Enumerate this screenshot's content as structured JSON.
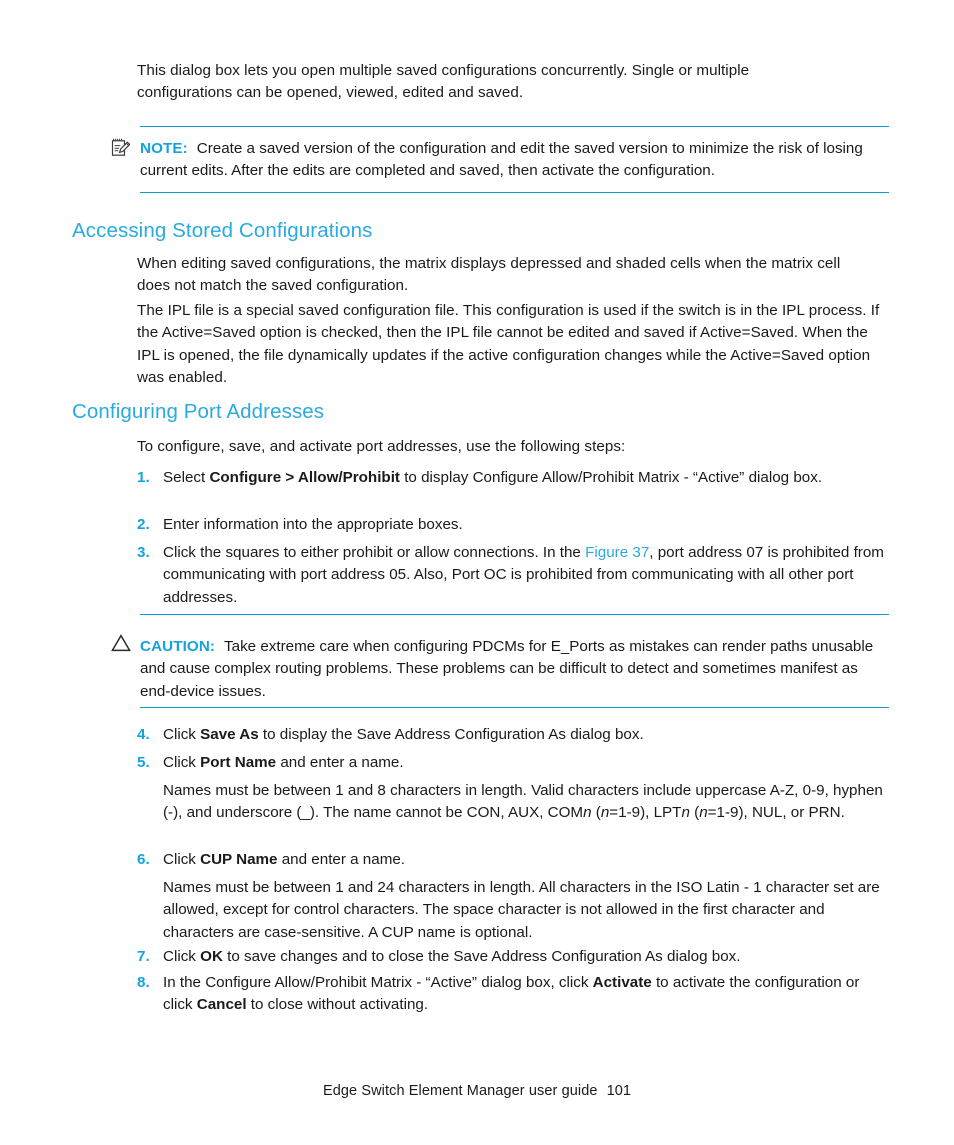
{
  "page": {
    "footer_title": "Edge Switch Element Manager user guide",
    "footer_page_number": "101",
    "accent_color": "#2aaae1",
    "rule_color": "#0b9ad4"
  },
  "intro": {
    "paragraph": "This dialog box lets you open multiple saved configurations concurrently. Single or multiple configurations can be opened, viewed, edited and saved."
  },
  "note": {
    "icon": "note-pad-pencil-icon",
    "label": "NOTE:",
    "text": "Create a saved version of the configuration and edit the saved version to minimize the risk of losing current edits. After the edits are completed and saved, then activate the configuration."
  },
  "section_accessing": {
    "heading": "Accessing Stored Configurations",
    "paragraph1": "When editing saved configurations, the matrix displays depressed and shaded cells when the matrix cell does not match the saved configuration.",
    "paragraph2": "The IPL file is a special saved configuration file. This configuration is used if the switch is in the IPL process. If the Active=Saved option is checked, then the IPL file cannot be edited and saved if Active=Saved. When the IPL is opened, the file dynamically updates if the active configuration changes while the Active=Saved option was enabled."
  },
  "section_configuring": {
    "heading": "Configuring Port Addresses",
    "intro": "To configure, save, and activate port addresses, use the following steps:",
    "steps": [
      {
        "number": "1.",
        "pre": "Select ",
        "bold": "Configure > Allow/Prohibit",
        "post": " to display Configure Allow/Prohibit Matrix - “Active” dialog box."
      },
      {
        "number": "2.",
        "pre": "Enter information into the appropriate boxes.",
        "bold": "",
        "post": ""
      },
      {
        "number": "3.",
        "pre": "Click the squares to either prohibit or allow connections. In the ",
        "link": "Figure 37",
        "post": ", port address 07 is prohibited from communicating with port address 05. Also, Port OC is prohibited from communicating with all other port addresses."
      },
      {
        "number": "4.",
        "pre": "Click ",
        "bold": "Save As",
        "post": " to display the Save Address Configuration As dialog box."
      },
      {
        "number": "5.",
        "pre": "Click ",
        "bold": "Port Name",
        "post": " and enter a name."
      },
      {
        "number": "6.",
        "pre": "Click ",
        "bold": "CUP Name",
        "post": " and enter a name."
      },
      {
        "number": "7.",
        "pre": "Click ",
        "bold": "OK",
        "post": " to save changes and to close the Save Address Configuration As dialog box."
      },
      {
        "number": "8.",
        "pre": "In the Configure Allow/Prohibit Matrix - “Active” dialog box, click ",
        "bold": "Activate",
        "mid": " to activate the configuration or click ",
        "bold2": "Cancel",
        "post": " to close without activating."
      }
    ],
    "note_port_name_a": "Names must be between 1 and 8 characters in length. Valid characters include uppercase A-Z, 0-9, hyphen (-), and underscore (_). The name cannot be CON, AUX, COM",
    "note_port_name_italic1": "n",
    "note_port_name_b": " (",
    "note_port_name_italic2": "n",
    "note_port_name_c": "=1-9), LPT",
    "note_port_name_italic3": "n",
    "note_port_name_d": " (",
    "note_port_name_italic4": "n",
    "note_port_name_e": "=1-9), NUL, or PRN.",
    "note_cup_name": "Names must be between 1 and 24 characters in length. All characters in the ISO Latin - 1 character set are allowed, except for control characters. The space character is not allowed in the first character and characters are case-sensitive. A CUP name is optional."
  },
  "caution": {
    "icon": "warning-triangle-icon",
    "label": "CAUTION:",
    "text": "Take extreme care when configuring PDCMs for E_Ports as mistakes can render paths unusable and cause complex routing problems. These problems can be difficult to detect and sometimes manifest as end-device issues."
  }
}
